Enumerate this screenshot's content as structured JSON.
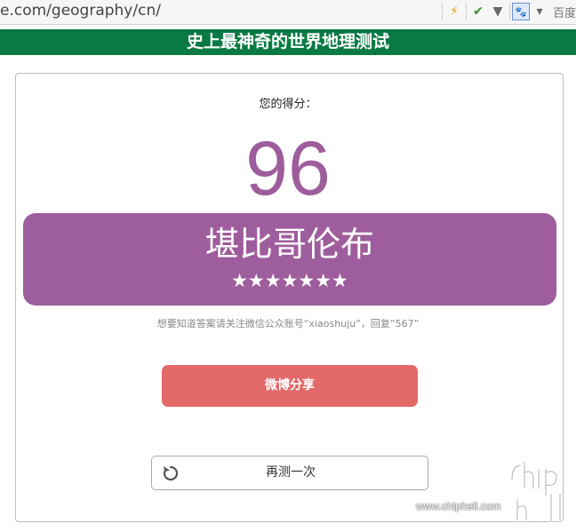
{
  "browser": {
    "url": "e.com/geography/cn/",
    "search_engine_label": "百度"
  },
  "header": {
    "title": "史上最神奇的世界地理测试"
  },
  "result": {
    "score_label": "您的得分：",
    "score": "96",
    "place": "堪比哥伦布",
    "stars": "★★★★★★★",
    "star_count": 7
  },
  "hint": "想要知道答案请关注微信公众账号“xiaoshuju”，回复“567”",
  "buttons": {
    "share": "微博分享",
    "retry": "再测一次"
  },
  "watermark": {
    "text": "www.chiphell.com"
  },
  "colors": {
    "header_green": "#0a7a44",
    "accent_purple": "#9e5d9c",
    "share_red": "#e26968"
  },
  "icons": {
    "retry": "refresh-icon",
    "bolt": "lightning-icon",
    "pin": "pin-icon",
    "search": "baidu-paw-icon"
  }
}
